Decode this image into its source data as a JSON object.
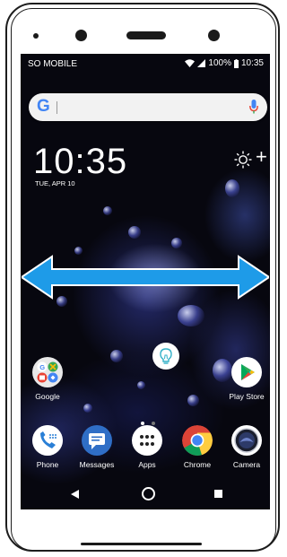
{
  "status_bar": {
    "carrier": "SO MOBILE",
    "battery": "100%",
    "time": "10:35"
  },
  "search": {
    "logo": "G",
    "mic_icon": "mic-icon"
  },
  "clock_widget": {
    "time": "10:35",
    "date": "TUE, APR 10",
    "weather_icon": "sun-icon",
    "add_label": "+"
  },
  "apps_row": [
    {
      "label": "Google",
      "icon": "google-folder-icon"
    },
    {
      "label": "Play Store",
      "icon": "play-store-icon"
    }
  ],
  "dock": [
    {
      "label": "Phone",
      "icon": "phone-icon"
    },
    {
      "label": "Messages",
      "icon": "messages-icon"
    },
    {
      "label": "Apps",
      "icon": "apps-grid-icon"
    },
    {
      "label": "Chrome",
      "icon": "chrome-icon"
    },
    {
      "label": "Camera",
      "icon": "camera-icon"
    }
  ],
  "colors": {
    "arrow": "#1e9be8",
    "wallpaper": "#07070f",
    "search_bg": "#f2f2f2"
  },
  "gesture": {
    "icon": "horizontal-swipe-arrow"
  }
}
